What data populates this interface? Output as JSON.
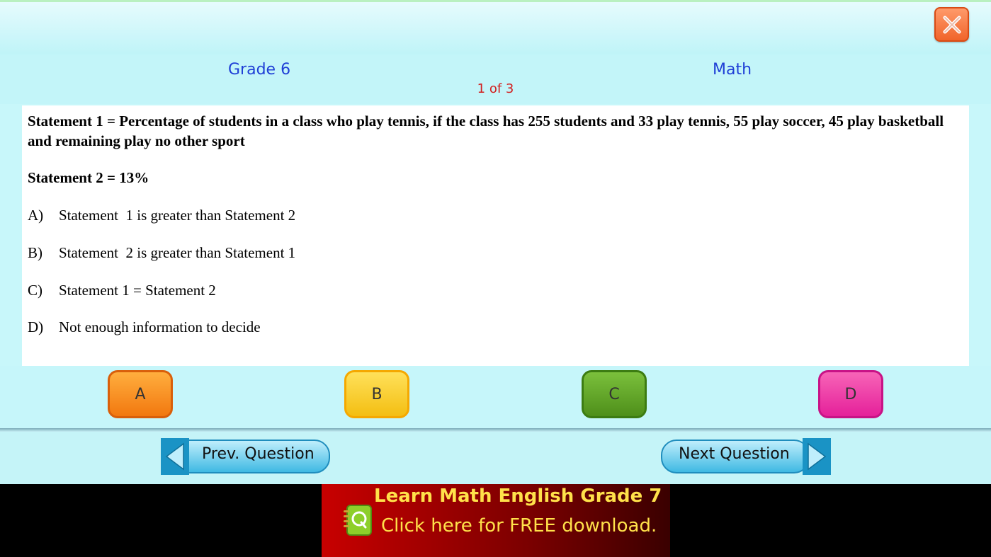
{
  "header": {
    "grade": "Grade 6",
    "subject": "Math",
    "counter": "1 of 3"
  },
  "question": {
    "statement1": "Statement 1 = Percentage of students in a class who play tennis, if the class has 255 students and 33 play tennis, 55 play soccer, 45 play basketball and remaining play no other sport",
    "statement2": "Statement 2 = 13%",
    "options": [
      {
        "letter": "A)",
        "text": "Statement  1 is greater than Statement 2"
      },
      {
        "letter": "B)",
        "text": "Statement  2 is greater than Statement 1"
      },
      {
        "letter": "C)",
        "text": "Statement 1 = Statement 2"
      },
      {
        "letter": "D)",
        "text": "Not enough information to decide"
      }
    ]
  },
  "answers": {
    "a": "A",
    "b": "B",
    "c": "C",
    "d": "D"
  },
  "nav": {
    "prev_label": "Prev. Question",
    "next_label": "Next Question"
  },
  "ad": {
    "title": "Learn Math English Grade 7",
    "subtitle": "Click here for FREE download."
  },
  "colors": {
    "background": "#c8f7fa",
    "header_text": "#1f3fd6",
    "counter_text": "#d21f1f",
    "btn_a": "#f2780f",
    "btn_b": "#f3be12",
    "btn_c": "#4e8f1a",
    "btn_d": "#e5209a",
    "ad_text": "#ffe14a"
  },
  "icons": {
    "close": "close-x-icon",
    "prev": "arrow-left-icon",
    "next": "arrow-right-icon",
    "ad_logo": "notebook-q-icon"
  }
}
